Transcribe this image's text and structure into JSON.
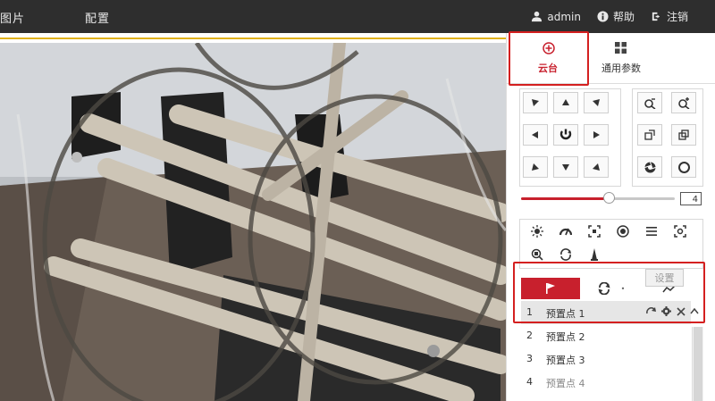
{
  "topbar": {
    "nav_items": [
      "图片",
      "配置"
    ],
    "user": "admin",
    "help": "帮助",
    "logout": "注销"
  },
  "panel": {
    "tabs": [
      {
        "label": "云台",
        "icon": "ptz-crosshair-icon"
      },
      {
        "label": "通用参数",
        "icon": "grid-squares-icon"
      }
    ],
    "speed": "4",
    "speed_level": 0.57,
    "tooltip": "设置",
    "presets": [
      {
        "num": "1",
        "name": "预置点 1",
        "selected": true
      },
      {
        "num": "2",
        "name": "预置点 2"
      },
      {
        "num": "3",
        "name": "预置点 3"
      },
      {
        "num": "4",
        "name": "预置点 4"
      }
    ]
  },
  "colors": {
    "accent_red": "#c8202d",
    "topbar_bg": "#2e2e2e",
    "highlight": "#d42020",
    "yellow_line": "#e0b21c"
  }
}
